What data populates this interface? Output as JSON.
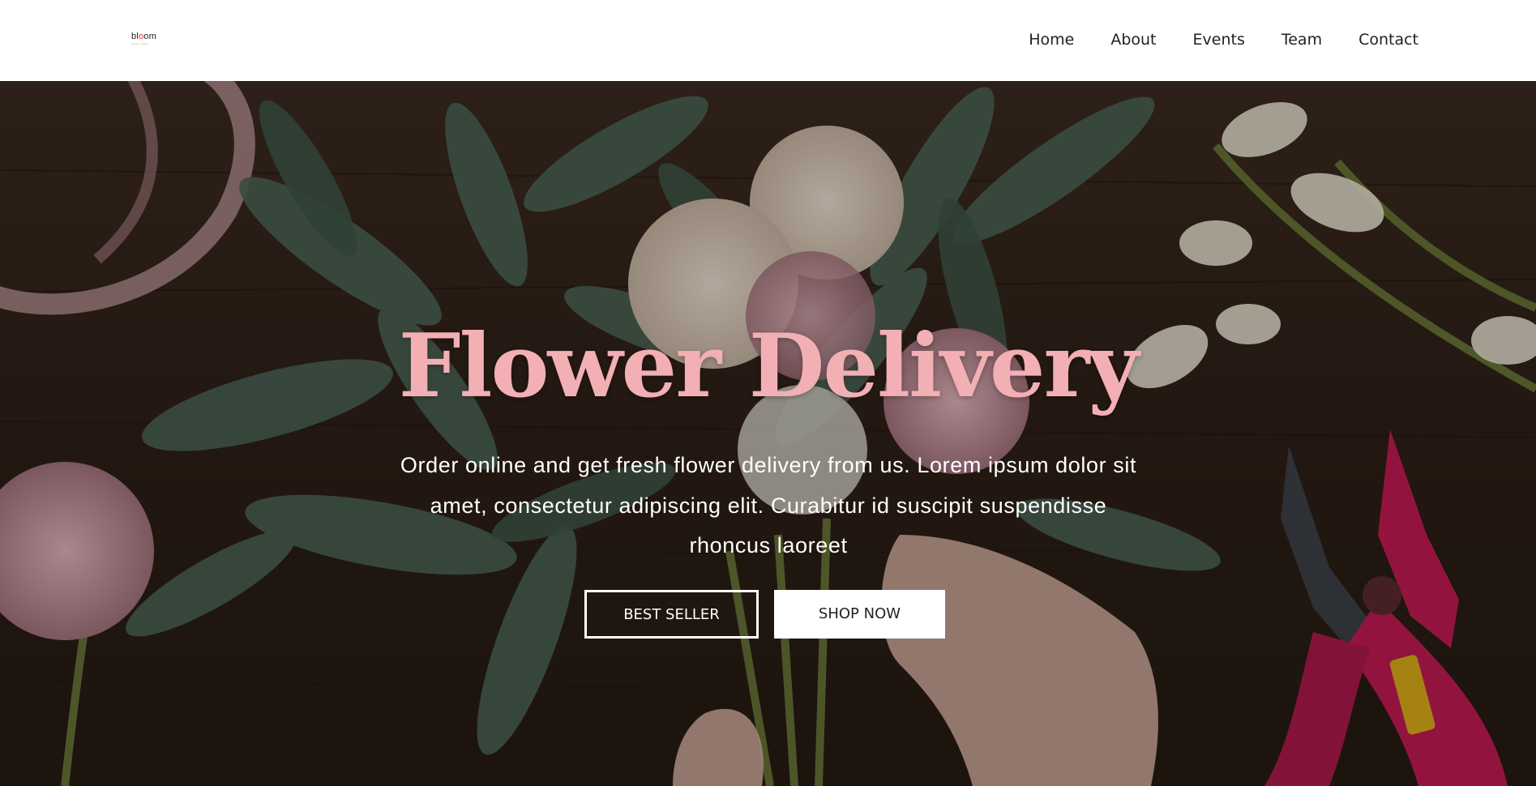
{
  "header": {
    "logo": {
      "text_pre": "bl",
      "text_o": "o",
      "text_post": "om",
      "tagline": "flower shop"
    },
    "nav": [
      "Home",
      "About",
      "Events",
      "Team",
      "Contact"
    ]
  },
  "hero": {
    "title": "Flower Delivery",
    "description": "Order online and get fresh flower delivery from us. Lorem ipsum dolor sit amet, consectetur adipiscing elit. Curabitur id suscipit suspendisse rhoncus laoreet",
    "buttons": {
      "best_seller": "BEST SELLER",
      "shop_now": "SHOP NOW"
    }
  },
  "colors": {
    "title_pink": "#f2b0b4",
    "header_bg": "#ffffff",
    "wood_dark": "#2e2119",
    "logo_accent": "#e0383f"
  },
  "icons": {
    "hero_image": "flower-bouquet-photo"
  }
}
